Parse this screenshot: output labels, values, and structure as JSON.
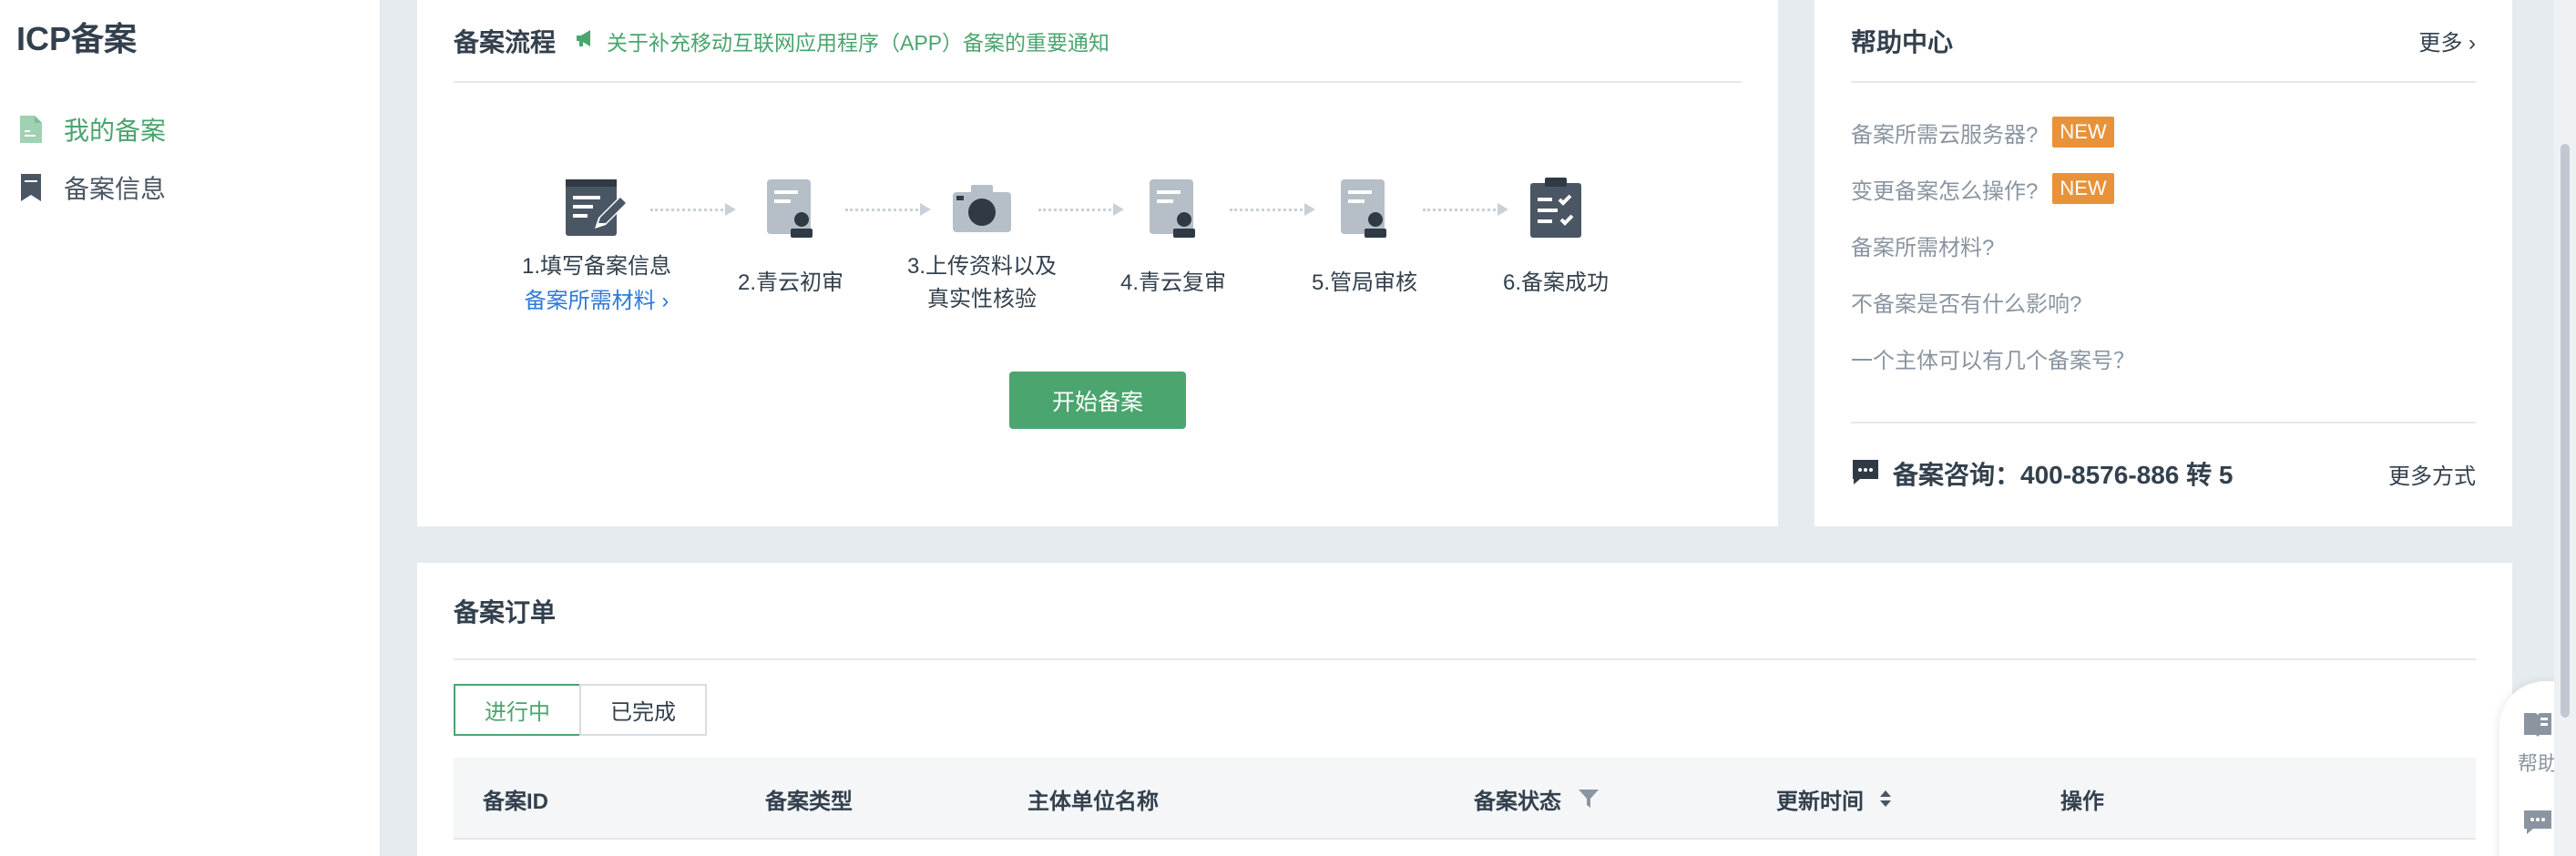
{
  "sidebar": {
    "title": "ICP备案",
    "items": [
      {
        "label": "我的备案",
        "icon": "document-icon"
      },
      {
        "label": "备案信息",
        "icon": "bookmark-icon"
      }
    ]
  },
  "process": {
    "title": "备案流程",
    "notice": "关于补充移动互联网应用程序（APP）备案的重要通知",
    "steps": [
      {
        "line1": "1.填写备案信息",
        "link": "备案所需材料 ›",
        "icon": "form-edit-icon"
      },
      {
        "line1": "2.青云初审",
        "icon": "review-stamp-icon"
      },
      {
        "line1": "3.上传资料以及",
        "line2": "真实性核验",
        "icon": "camera-icon"
      },
      {
        "line1": "4.青云复审",
        "icon": "review-stamp-icon"
      },
      {
        "line1": "5.管局审核",
        "icon": "review-stamp-icon"
      },
      {
        "line1": "6.备案成功",
        "icon": "clipboard-check-icon"
      }
    ],
    "start_button": "开始备案"
  },
  "help": {
    "title": "帮助中心",
    "more": "更多 ›",
    "items": [
      {
        "label": "备案所需云服务器?",
        "badge": "NEW"
      },
      {
        "label": "变更备案怎么操作?",
        "badge": "NEW"
      },
      {
        "label": "备案所需材料?"
      },
      {
        "label": "不备案是否有什么影响?"
      },
      {
        "label": "一个主体可以有几个备案号？"
      }
    ],
    "consult": "备案咨询：400-8576-886 转 5",
    "consult_more": "更多方式"
  },
  "orders": {
    "title": "备案订单",
    "tabs": [
      {
        "label": "进行中",
        "active": true
      },
      {
        "label": "已完成",
        "active": false
      }
    ],
    "columns": [
      {
        "label": "备案ID"
      },
      {
        "label": "备案类型"
      },
      {
        "label": "主体单位名称"
      },
      {
        "label": "备案状态",
        "icon": "filter-icon"
      },
      {
        "label": "更新时间",
        "icon": "sort-icon"
      },
      {
        "label": "操作"
      }
    ]
  },
  "float_panel": {
    "help_label": "帮助"
  },
  "colors": {
    "accent": "#4aa56e",
    "link": "#2f7ad8",
    "badge": "#e8933a",
    "text": "#33404d",
    "muted": "#8a95a1",
    "icon_dark": "#4a5663"
  }
}
